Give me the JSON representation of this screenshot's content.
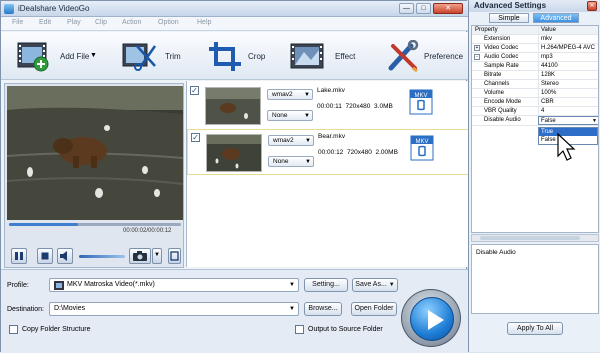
{
  "app": {
    "title": "iDealshare VideoGo"
  },
  "window_controls": {
    "minimize": "—",
    "maximize": "□",
    "close": "✕"
  },
  "menu": [
    "File",
    "Edit",
    "Play",
    "Clip",
    "Action",
    "Option",
    "Help"
  ],
  "toolbar": {
    "add_file": "Add File",
    "trim": "Trim",
    "crop": "Crop",
    "effect": "Effect",
    "preference": "Preference"
  },
  "player": {
    "time_current": "00:00:02",
    "time_total": "00:00:12",
    "progress": 0.4
  },
  "files": [
    {
      "name": "Lake.mkv",
      "duration": "00:00:11",
      "resolution": "720x480",
      "size": "3.0MB",
      "audio": "wmav2",
      "subtitle": "None",
      "format_badge": "MKV"
    },
    {
      "name": "Bear.mkv",
      "duration": "00:00:12",
      "resolution": "720x480",
      "size": "2.00MB",
      "audio": "wmav2",
      "subtitle": "None",
      "format_badge": "MKV"
    }
  ],
  "output": {
    "profile_label": "Profile:",
    "profile_value": "MKV Matroska Video(*.mkv)",
    "setting_button": "Setting...",
    "save_as_button": "Save As...",
    "destination_label": "Destination:",
    "destination_value": "D:\\Movies",
    "browse_button": "Browse...",
    "open_folder_button": "Open Folder",
    "copy_folder_label": "Copy Folder Structure",
    "output_source_label": "Output to Source Folder"
  },
  "advanced": {
    "title": "Advanced Settings",
    "close": "✕",
    "tabs": [
      "Simple",
      "Advanced"
    ],
    "active_tab": "Advanced",
    "header": {
      "property": "Property",
      "value": "Value"
    },
    "rows": [
      {
        "key": "Extension",
        "value": "mkv",
        "expander": ""
      },
      {
        "key": "Video Codec",
        "value": "H.264/MPEG-4 AVC",
        "expander": "+"
      },
      {
        "key": "Audio Codec",
        "value": "mp3",
        "expander": "-"
      },
      {
        "key": "Sample Rate",
        "value": "44100",
        "expander": ""
      },
      {
        "key": "Bitrate",
        "value": "128K",
        "expander": ""
      },
      {
        "key": "Channels",
        "value": "Stereo",
        "expander": ""
      },
      {
        "key": "Volume",
        "value": "100%",
        "expander": ""
      },
      {
        "key": "Encode Mode",
        "value": "CBR",
        "expander": ""
      },
      {
        "key": "VBR Quality",
        "value": "4",
        "expander": ""
      },
      {
        "key": "Disable Audio",
        "value": "False",
        "expander": ""
      }
    ],
    "dropdown_options": [
      "True",
      "False"
    ],
    "description": "Disable Audio",
    "apply_all": "Apply To All"
  }
}
